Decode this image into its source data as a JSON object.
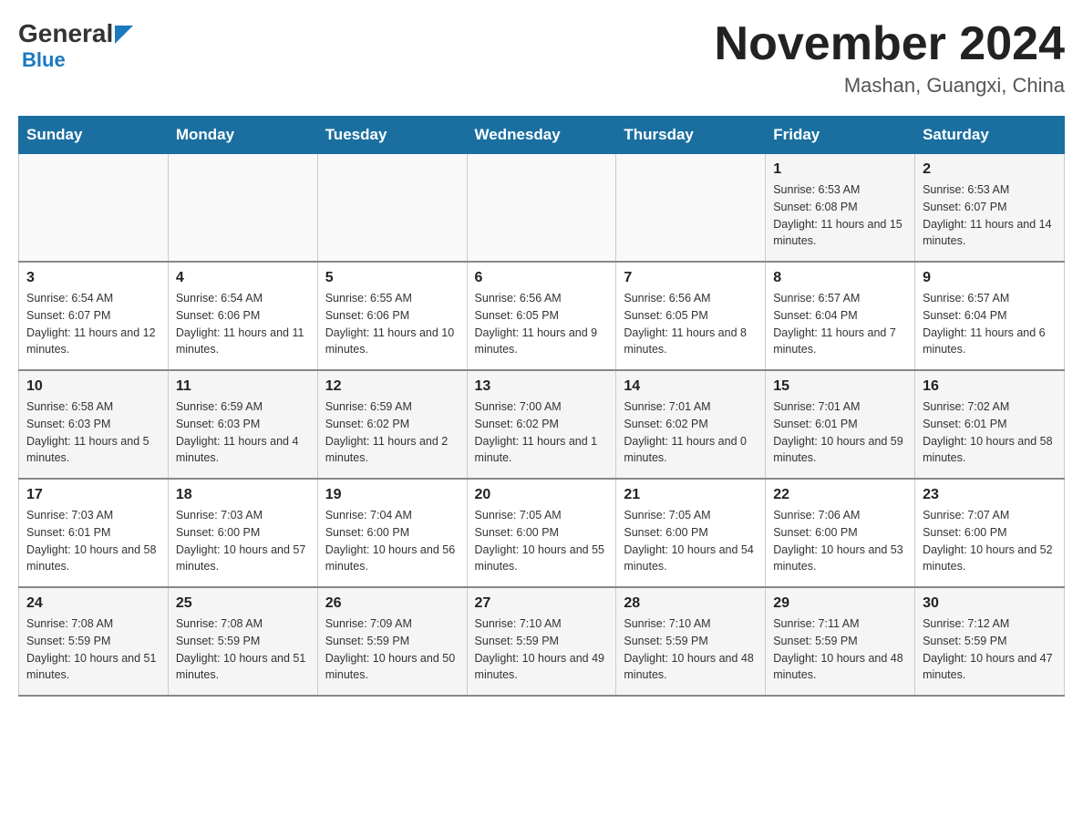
{
  "header": {
    "logo_general": "General",
    "logo_blue": "Blue",
    "month_title": "November 2024",
    "location": "Mashan, Guangxi, China"
  },
  "weekdays": [
    "Sunday",
    "Monday",
    "Tuesday",
    "Wednesday",
    "Thursday",
    "Friday",
    "Saturday"
  ],
  "weeks": [
    {
      "days": [
        {
          "num": "",
          "info": ""
        },
        {
          "num": "",
          "info": ""
        },
        {
          "num": "",
          "info": ""
        },
        {
          "num": "",
          "info": ""
        },
        {
          "num": "",
          "info": ""
        },
        {
          "num": "1",
          "info": "Sunrise: 6:53 AM\nSunset: 6:08 PM\nDaylight: 11 hours and 15 minutes."
        },
        {
          "num": "2",
          "info": "Sunrise: 6:53 AM\nSunset: 6:07 PM\nDaylight: 11 hours and 14 minutes."
        }
      ]
    },
    {
      "days": [
        {
          "num": "3",
          "info": "Sunrise: 6:54 AM\nSunset: 6:07 PM\nDaylight: 11 hours and 12 minutes."
        },
        {
          "num": "4",
          "info": "Sunrise: 6:54 AM\nSunset: 6:06 PM\nDaylight: 11 hours and 11 minutes."
        },
        {
          "num": "5",
          "info": "Sunrise: 6:55 AM\nSunset: 6:06 PM\nDaylight: 11 hours and 10 minutes."
        },
        {
          "num": "6",
          "info": "Sunrise: 6:56 AM\nSunset: 6:05 PM\nDaylight: 11 hours and 9 minutes."
        },
        {
          "num": "7",
          "info": "Sunrise: 6:56 AM\nSunset: 6:05 PM\nDaylight: 11 hours and 8 minutes."
        },
        {
          "num": "8",
          "info": "Sunrise: 6:57 AM\nSunset: 6:04 PM\nDaylight: 11 hours and 7 minutes."
        },
        {
          "num": "9",
          "info": "Sunrise: 6:57 AM\nSunset: 6:04 PM\nDaylight: 11 hours and 6 minutes."
        }
      ]
    },
    {
      "days": [
        {
          "num": "10",
          "info": "Sunrise: 6:58 AM\nSunset: 6:03 PM\nDaylight: 11 hours and 5 minutes."
        },
        {
          "num": "11",
          "info": "Sunrise: 6:59 AM\nSunset: 6:03 PM\nDaylight: 11 hours and 4 minutes."
        },
        {
          "num": "12",
          "info": "Sunrise: 6:59 AM\nSunset: 6:02 PM\nDaylight: 11 hours and 2 minutes."
        },
        {
          "num": "13",
          "info": "Sunrise: 7:00 AM\nSunset: 6:02 PM\nDaylight: 11 hours and 1 minute."
        },
        {
          "num": "14",
          "info": "Sunrise: 7:01 AM\nSunset: 6:02 PM\nDaylight: 11 hours and 0 minutes."
        },
        {
          "num": "15",
          "info": "Sunrise: 7:01 AM\nSunset: 6:01 PM\nDaylight: 10 hours and 59 minutes."
        },
        {
          "num": "16",
          "info": "Sunrise: 7:02 AM\nSunset: 6:01 PM\nDaylight: 10 hours and 58 minutes."
        }
      ]
    },
    {
      "days": [
        {
          "num": "17",
          "info": "Sunrise: 7:03 AM\nSunset: 6:01 PM\nDaylight: 10 hours and 58 minutes."
        },
        {
          "num": "18",
          "info": "Sunrise: 7:03 AM\nSunset: 6:00 PM\nDaylight: 10 hours and 57 minutes."
        },
        {
          "num": "19",
          "info": "Sunrise: 7:04 AM\nSunset: 6:00 PM\nDaylight: 10 hours and 56 minutes."
        },
        {
          "num": "20",
          "info": "Sunrise: 7:05 AM\nSunset: 6:00 PM\nDaylight: 10 hours and 55 minutes."
        },
        {
          "num": "21",
          "info": "Sunrise: 7:05 AM\nSunset: 6:00 PM\nDaylight: 10 hours and 54 minutes."
        },
        {
          "num": "22",
          "info": "Sunrise: 7:06 AM\nSunset: 6:00 PM\nDaylight: 10 hours and 53 minutes."
        },
        {
          "num": "23",
          "info": "Sunrise: 7:07 AM\nSunset: 6:00 PM\nDaylight: 10 hours and 52 minutes."
        }
      ]
    },
    {
      "days": [
        {
          "num": "24",
          "info": "Sunrise: 7:08 AM\nSunset: 5:59 PM\nDaylight: 10 hours and 51 minutes."
        },
        {
          "num": "25",
          "info": "Sunrise: 7:08 AM\nSunset: 5:59 PM\nDaylight: 10 hours and 51 minutes."
        },
        {
          "num": "26",
          "info": "Sunrise: 7:09 AM\nSunset: 5:59 PM\nDaylight: 10 hours and 50 minutes."
        },
        {
          "num": "27",
          "info": "Sunrise: 7:10 AM\nSunset: 5:59 PM\nDaylight: 10 hours and 49 minutes."
        },
        {
          "num": "28",
          "info": "Sunrise: 7:10 AM\nSunset: 5:59 PM\nDaylight: 10 hours and 48 minutes."
        },
        {
          "num": "29",
          "info": "Sunrise: 7:11 AM\nSunset: 5:59 PM\nDaylight: 10 hours and 48 minutes."
        },
        {
          "num": "30",
          "info": "Sunrise: 7:12 AM\nSunset: 5:59 PM\nDaylight: 10 hours and 47 minutes."
        }
      ]
    }
  ]
}
